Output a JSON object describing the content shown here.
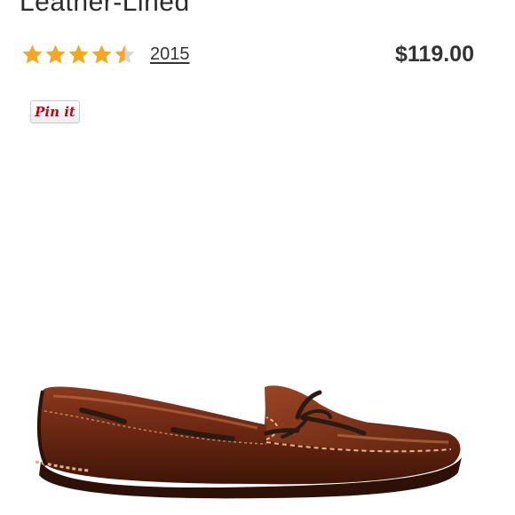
{
  "product": {
    "title": "Leather-Lined",
    "rating": 4.5,
    "rating_max": 5,
    "review_count": "2015",
    "price": "$119.00"
  },
  "share": {
    "pin_label": "Pin it"
  },
  "colors": {
    "star": "#f5a623",
    "star_empty": "#d8d8d8",
    "pinterest": "#bd081c",
    "leather": "#6e2a14"
  },
  "icons": {
    "rating": "star-icon",
    "image": "moccasin-shoe"
  }
}
